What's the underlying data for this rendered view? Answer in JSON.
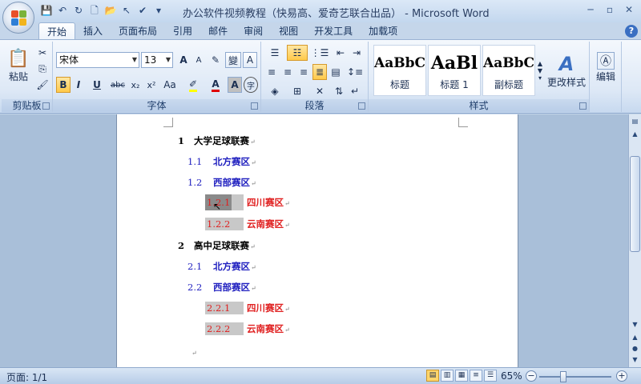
{
  "window": {
    "title": "办公软件视频教程（快易高、爱奇艺联合出品） - Microsoft Word",
    "controls": {
      "minimize": "─",
      "maximize": "▫",
      "close": "✕"
    }
  },
  "tabs": [
    {
      "label": "开始",
      "active": true
    },
    {
      "label": "插入"
    },
    {
      "label": "页面布局"
    },
    {
      "label": "引用"
    },
    {
      "label": "邮件"
    },
    {
      "label": "审阅"
    },
    {
      "label": "视图"
    },
    {
      "label": "开发工具"
    },
    {
      "label": "加载项"
    }
  ],
  "ribbon": {
    "clipboard": {
      "label": "剪贴板",
      "paste": "粘贴"
    },
    "font": {
      "label": "字体",
      "family": "宋体",
      "size": "13",
      "bold": "B",
      "italic": "I",
      "underline": "U",
      "strike": "abc",
      "subscript": "x₂",
      "superscript": "x²",
      "case": "Aa",
      "grow": "A",
      "shrink": "A",
      "clear": "✎",
      "phonetic": "變",
      "border_char": "A",
      "color_a": "A",
      "shade_a": "A",
      "enclose": "字"
    },
    "paragraph": {
      "label": "段落"
    },
    "styles": {
      "label": "样式",
      "items": [
        {
          "sample": "AaBbC",
          "name": "标题"
        },
        {
          "sample": "AaBl",
          "name": "标题 1"
        },
        {
          "sample": "AaBbC",
          "name": "副标题"
        }
      ],
      "change": "更改样式"
    },
    "editing": {
      "label": "编辑"
    }
  },
  "document": {
    "lines": [
      {
        "num": "1",
        "text": "大学足球联赛",
        "level": 1
      },
      {
        "num": "1.1",
        "text": "北方赛区",
        "level": 2
      },
      {
        "num": "1.2",
        "text": "西部赛区",
        "level": 2
      },
      {
        "num": "1.2.1",
        "text": "四川赛区",
        "level": 3
      },
      {
        "num": "1.2.2",
        "text": "云南赛区",
        "level": 3
      },
      {
        "num": "2",
        "text": "高中足球联赛",
        "level": 1
      },
      {
        "num": "2.1",
        "text": "北方赛区",
        "level": 2
      },
      {
        "num": "2.2",
        "text": "西部赛区",
        "level": 2
      },
      {
        "num": "2.2.1",
        "text": "四川赛区",
        "level": 3
      },
      {
        "num": "2.2.2",
        "text": "云南赛区",
        "level": 3
      }
    ],
    "colors": {
      "level1": "#000000",
      "level2": "#1f1fbf",
      "level3": "#e02020"
    }
  },
  "status": {
    "page": "页面: 1/1",
    "zoom": "65%",
    "zoom_minus": "−",
    "zoom_plus": "+"
  }
}
